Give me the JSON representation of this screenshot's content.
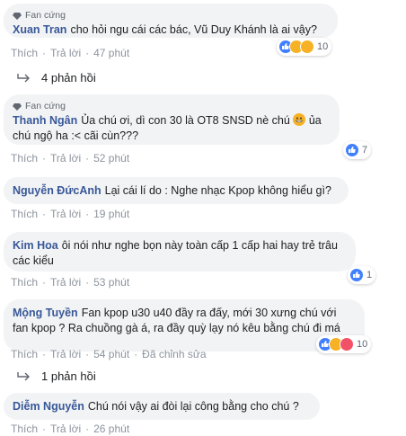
{
  "actions": {
    "like": "Thích",
    "reply": "Trả lời",
    "edited": "Đã chỉnh sửa"
  },
  "comments": [
    {
      "badge": "Fan cứng",
      "author": "Xuan Tran",
      "text": "cho hỏi ngu cái các bác, Vũ Duy Khánh là ai vậy?",
      "time": "47 phút",
      "reaction_count": "10",
      "replies": "4 phản hồi"
    },
    {
      "badge": "Fan cứng",
      "author": "Thanh Ngân",
      "text": "Ủa chú ơi, dì con 30 là OT8 SNSD nè chú",
      "text_after_emoji": "ủa chú ngộ ha :< cãi cùn???",
      "time": "52 phút",
      "reaction_count": "7"
    },
    {
      "author": "Nguyễn ĐứcAnh",
      "text": "Lại cái lí do : Nghe nhạc Kpop không hiểu gì?",
      "time": "19 phút"
    },
    {
      "author": "Kim Hoa",
      "text": "ôi nói như nghe bọn này toàn cấp 1 cấp hai hay trẻ trâu các kiểu",
      "time": "53 phút",
      "reaction_count": "1"
    },
    {
      "author": "Mộng Tuyền",
      "text": "Fan kpop u30 u40 đầy ra đấy, mới 30 xưng chú với fan kpop ? Ra chuồng gà á, ra đầy quỳ lạy nó kêu bằng chú đi má",
      "time": "54 phút",
      "reaction_count": "10",
      "replies": "1 phản hồi"
    },
    {
      "author": "Diễm Nguyễn",
      "text": "Chú nói vậy ai đòi lại công bằng cho chú ?",
      "time": "26 phút"
    }
  ],
  "colors": {
    "author": "#385898",
    "bubble": "#f2f3f5",
    "meta": "#8d949e",
    "like": "#4080ff"
  }
}
